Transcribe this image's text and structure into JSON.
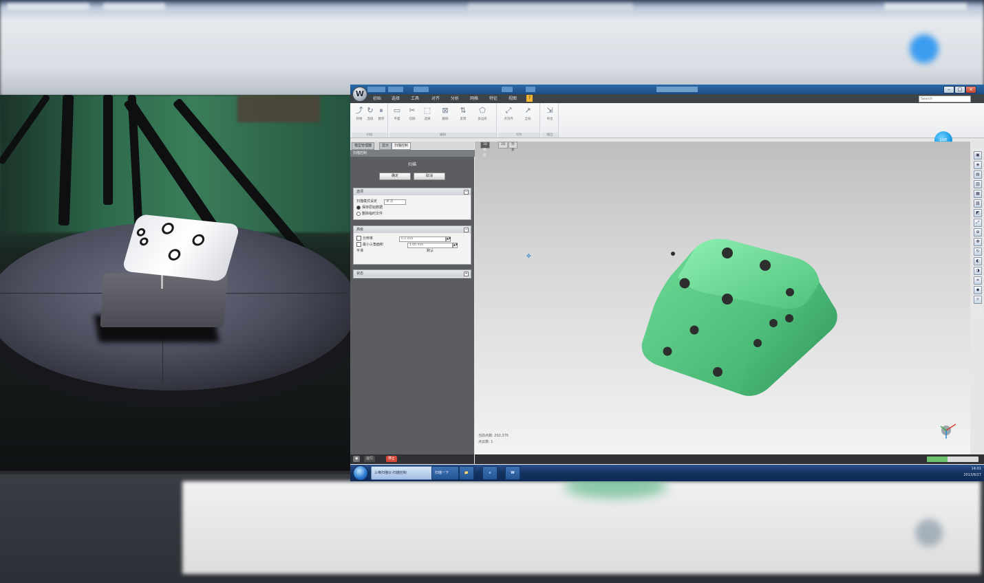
{
  "app": {
    "logo_letter": "W",
    "help_search_placeholder": "Search",
    "menu": [
      "初始",
      "选择",
      "工具",
      "对齐",
      "分析",
      "网格",
      "特征",
      "视图",
      "?"
    ],
    "menu_active_index": 8,
    "live_badge": "LIVE",
    "window_controls": [
      "–",
      "□",
      "×"
    ]
  },
  "ribbon": {
    "groups": [
      {
        "label": "扫描",
        "buttons": [
          "开始",
          "连续",
          "暂停"
        ]
      },
      {
        "label": "编辑",
        "buttons": [
          "平面",
          "切除",
          "选择",
          "删除",
          "反转",
          "多边形"
        ]
      },
      {
        "label": "对齐",
        "buttons": [
          "点对齐",
          "全局"
        ]
      },
      {
        "label": "输出",
        "buttons": [
          "导出"
        ]
      }
    ]
  },
  "panel": {
    "tabs": [
      "模型管理器",
      "显示",
      "扫描控制"
    ],
    "active_tab_index": 2,
    "header": "扫描控制",
    "title": "扫描",
    "buttons": {
      "ok": "确定",
      "cancel": "取消"
    },
    "sections": [
      {
        "title": "选项",
        "rows": [
          {
            "type": "select",
            "label": "扫描模式设定",
            "value": "单 次"
          },
          {
            "type": "radio",
            "label": "保存原始数据",
            "checked": true
          },
          {
            "type": "radio",
            "label": "删除临时文件",
            "checked": false
          }
        ]
      },
      {
        "title": "高级",
        "rows": [
          {
            "type": "checkbox",
            "label": "分辨率",
            "value": "0.2 mm"
          },
          {
            "type": "checkbox",
            "label": "最小三角面积",
            "value": "1.00 mm"
          },
          {
            "type": "text",
            "label": "平滑",
            "value": "默认"
          }
        ]
      },
      {
        "title": "状态",
        "rows": []
      }
    ]
  },
  "statusbar_tabs": [
    "●",
    "运行",
    "停止"
  ],
  "viewport": {
    "tabs": [
      "3D视图",
      "2D",
      "列表"
    ],
    "active_tab_index": 0,
    "info_lines": [
      "当前点数: 202,375",
      "点云数: 1"
    ],
    "model": "green-die-mesh"
  },
  "toolstrip": [
    "front-view-icon",
    "back-view-icon",
    "left-view-icon",
    "right-view-icon",
    "top-view-icon",
    "bottom-view-icon",
    "iso-view-icon",
    "fit-icon",
    "zoom-icon",
    "pan-icon",
    "rotate-icon",
    "render-icon",
    "shade-icon",
    "wire-icon",
    "color-icon",
    "light-icon"
  ],
  "taskbar": {
    "tasks": [
      "三维扫描仪-扫描控制",
      "扫描一下"
    ],
    "clock_time": "14:01",
    "clock_date": "2013/8/27"
  },
  "colors": {
    "mesh": "#5fd18a",
    "menu_active": "#f2b632",
    "title_bar": "#1c4d86",
    "live": "#1a9be6"
  }
}
